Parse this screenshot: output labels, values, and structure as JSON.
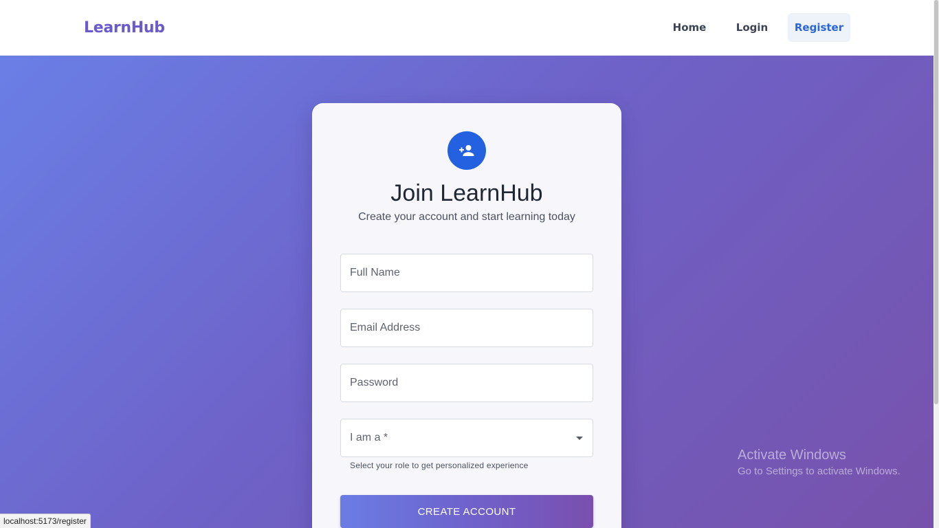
{
  "header": {
    "brand": "LearnHub",
    "nav": {
      "home": "Home",
      "login": "Login",
      "register": "Register"
    }
  },
  "register_card": {
    "icon": "person-add-icon",
    "title": "Join LearnHub",
    "subtitle": "Create your account and start learning today",
    "fields": {
      "full_name": {
        "placeholder": "Full Name",
        "value": ""
      },
      "email": {
        "placeholder": "Email Address",
        "value": ""
      },
      "password": {
        "placeholder": "Password",
        "value": ""
      },
      "role": {
        "label": "I am a *",
        "selected": "",
        "helper": "Select your role to get personalized experience"
      }
    },
    "submit_label": "CREATE ACCOUNT"
  },
  "os_watermark": {
    "title": "Activate Windows",
    "subtitle": "Go to Settings to activate Windows."
  },
  "status_bar": {
    "url": "localhost:5173/register"
  },
  "colors": {
    "brand": "#6a5bcc",
    "accent_blue": "#2461e0",
    "gradient_start": "#6a7fe6",
    "gradient_end": "#7752ab"
  }
}
